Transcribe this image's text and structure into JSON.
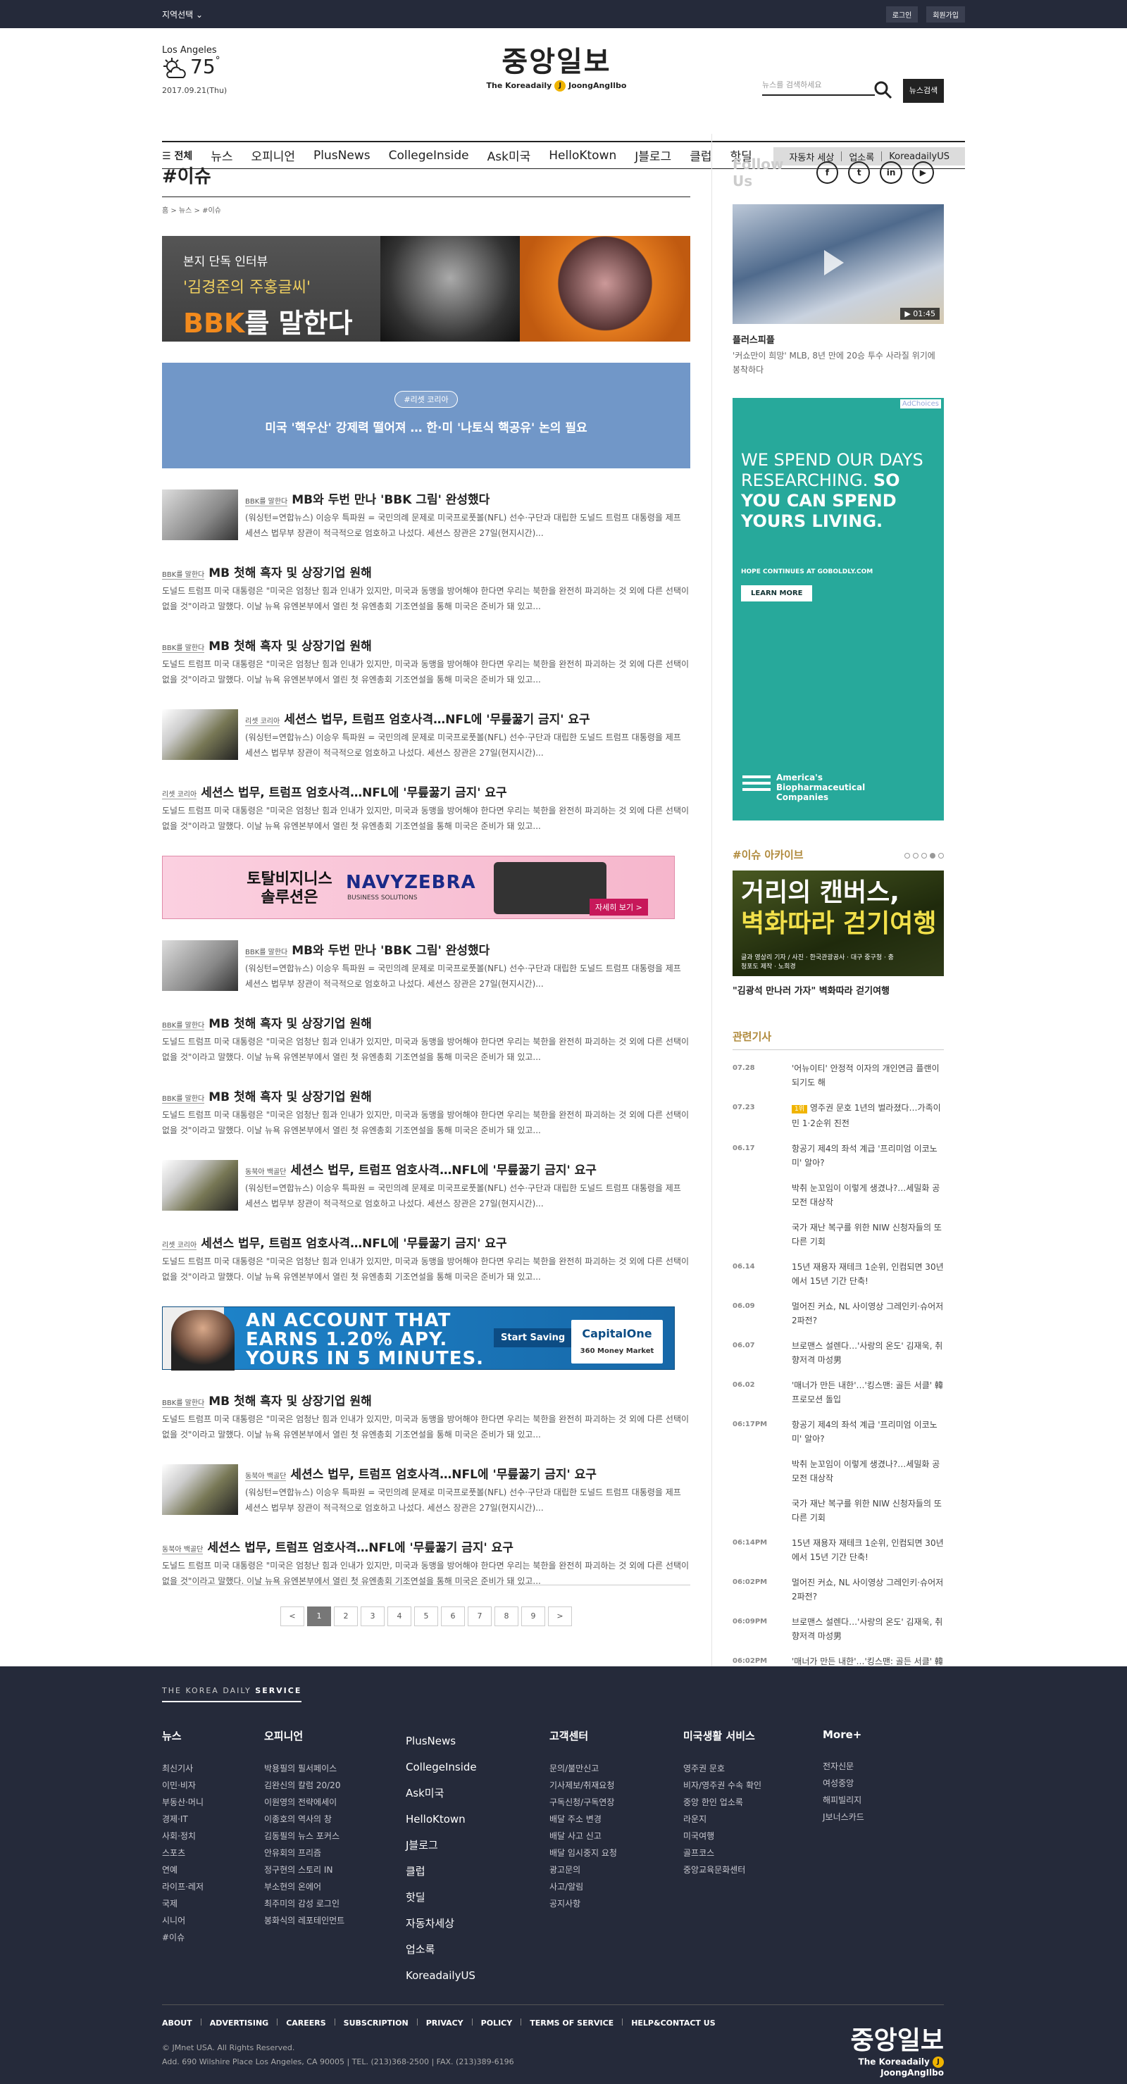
{
  "topbar": {
    "region": "지역선택",
    "login": "로그인",
    "join": "회원가입"
  },
  "weather": {
    "city": "Los Angeles",
    "temp": "75",
    "unit": "°",
    "date": "2017.09.21(Thu)"
  },
  "logo": {
    "ko": "중앙일보",
    "en_pre": "The Koreadaily",
    "en_mark": "J",
    "en_post": "JoongAngIlbo"
  },
  "search": {
    "placeholder": "뉴스를 검색하세요",
    "button": "뉴스검색"
  },
  "nav": {
    "all": "전체",
    "items": [
      "뉴스",
      "오피니언",
      "PlusNews",
      "CollegeInside",
      "Ask미국",
      "HelloKtown",
      "J블로그",
      "클럽",
      "핫딜"
    ],
    "extra": [
      "자동차 세상",
      "업소록",
      "KoreadailyUS"
    ]
  },
  "page": {
    "title": "#이슈",
    "breadcrumb": "홈 > 뉴스 > #이슈"
  },
  "banner_bbk": {
    "l1": "본지 단독 인터뷰",
    "l2": "'김경준의 주홍글씨'",
    "l3a": "BBK",
    "l3b": "를 말한다"
  },
  "banner_blue": {
    "tag": "#리셋 코리아",
    "title": "미국 '핵우산' 강제력 떨어져 … 한·미 '나토식 핵공유' 논의 필요"
  },
  "articles1": [
    {
      "sec": "BBK를 말한다",
      "title": "MB와 두번 만나 'BBK 그림' 완성했다",
      "summary": "(워싱턴=연합뉴스) 이승우 특파원 = 국민의례 문제로 미국프로풋볼(NFL) 선수·구단과 대립한 도널드 트럼프 대통령을 제프 세션스 법무부 장관이 적극적으로 엄호하고 나섰다. 세션스 장관은 27일(현지시간)..."
    },
    {
      "sec": "BBK를 말한다",
      "title": "MB 첫해 흑자 및 상장기업 원해",
      "summary": "도널드 트럼프 미국 대통령은 \"미국은 엄청난 힘과 인내가 있지만, 미국과 동맹을 방어해야 한다면 우리는 북한을 완전히 파괴하는 것 외에 다른 선택이 없을 것\"이라고 말했다. 이날 뉴욕 유엔본부에서 열린 첫 유엔총회 기조연설을 통해 미국은 준비가 돼 있고..."
    },
    {
      "sec": "BBK를 말한다",
      "title": "MB 첫해 흑자 및 상장기업 원해",
      "summary": "도널드 트럼프 미국 대통령은 \"미국은 엄청난 힘과 인내가 있지만, 미국과 동맹을 방어해야 한다면 우리는 북한을 완전히 파괴하는 것 외에 다른 선택이 없을 것\"이라고 말했다. 이날 뉴욕 유엔본부에서 열린 첫 유엔총회 기조연설을 통해 미국은 준비가 돼 있고..."
    },
    {
      "sec": "리셋 코리아",
      "title": "세션스 법무, 트럼프 엄호사격…NFL에 '무릎꿇기 금지' 요구",
      "summary": "(워싱턴=연합뉴스) 이승우 특파원 = 국민의례 문제로 미국프로풋볼(NFL) 선수·구단과 대립한 도널드 트럼프 대통령을 제프 세션스 법무부 장관이 적극적으로 엄호하고 나섰다. 세션스 장관은 27일(현지시간)..."
    },
    {
      "sec": "리셋 코리아",
      "title": "세션스 법무, 트럼프 엄호사격…NFL에 '무릎꿇기 금지' 요구",
      "summary": "도널드 트럼프 미국 대통령은 \"미국은 엄청난 힘과 인내가 있지만, 미국과 동맹을 방어해야 한다면 우리는 북한을 완전히 파괴하는 것 외에 다른 선택이 없을 것\"이라고 말했다. 이날 뉴욕 유엔본부에서 열린 첫 유엔총회 기조연설을 통해 미국은 준비가 돼 있고..."
    }
  ],
  "ad_navy": {
    "t1": "토탈비지니스 솔루션은",
    "brand": "NAVYZEBRA",
    "sub": "BUSINESS SOLUTIONS",
    "cta": "자세히 보기 >"
  },
  "articles2": [
    {
      "sec": "BBK를 말한다",
      "title": "MB와 두번 만나 'BBK 그림' 완성했다",
      "summary": "(워싱턴=연합뉴스) 이승우 특파원 = 국민의례 문제로 미국프로풋볼(NFL) 선수·구단과 대립한 도널드 트럼프 대통령을 제프 세션스 법무부 장관이 적극적으로 엄호하고 나섰다. 세션스 장관은 27일(현지시간)..."
    },
    {
      "sec": "BBK를 말한다",
      "title": "MB 첫해 흑자 및 상장기업 원해",
      "summary": "도널드 트럼프 미국 대통령은 \"미국은 엄청난 힘과 인내가 있지만, 미국과 동맹을 방어해야 한다면 우리는 북한을 완전히 파괴하는 것 외에 다른 선택이 없을 것\"이라고 말했다. 이날 뉴욕 유엔본부에서 열린 첫 유엔총회 기조연설을 통해 미국은 준비가 돼 있고..."
    },
    {
      "sec": "BBK를 말한다",
      "title": "MB 첫해 흑자 및 상장기업 원해",
      "summary": "도널드 트럼프 미국 대통령은 \"미국은 엄청난 힘과 인내가 있지만, 미국과 동맹을 방어해야 한다면 우리는 북한을 완전히 파괴하는 것 외에 다른 선택이 없을 것\"이라고 말했다. 이날 뉴욕 유엔본부에서 열린 첫 유엔총회 기조연설을 통해 미국은 준비가 돼 있고..."
    },
    {
      "sec": "동북아 백골단",
      "title": "세션스 법무, 트럼프 엄호사격…NFL에 '무릎꿇기 금지' 요구",
      "summary": "(워싱턴=연합뉴스) 이승우 특파원 = 국민의례 문제로 미국프로풋볼(NFL) 선수·구단과 대립한 도널드 트럼프 대통령을 제프 세션스 법무부 장관이 적극적으로 엄호하고 나섰다. 세션스 장관은 27일(현지시간)..."
    },
    {
      "sec": "리셋 코리아",
      "title": "세션스 법무, 트럼프 엄호사격…NFL에 '무릎꿇기 금지' 요구",
      "summary": "도널드 트럼프 미국 대통령은 \"미국은 엄청난 힘과 인내가 있지만, 미국과 동맹을 방어해야 한다면 우리는 북한을 완전히 파괴하는 것 외에 다른 선택이 없을 것\"이라고 말했다. 이날 뉴욕 유엔본부에서 열린 첫 유엔총회 기조연설을 통해 미국은 준비가 돼 있고..."
    }
  ],
  "ad_capital": {
    "text": "AN ACCOUNT THAT EARNS 1.20% APY. YOURS IN 5 MINUTES.",
    "btn": "Start Saving",
    "brand": "CapitalOne",
    "product": "360 Money Market"
  },
  "articles3": [
    {
      "sec": "BBK를 말한다",
      "title": "MB 첫해 흑자 및 상장기업 원해",
      "summary": "도널드 트럼프 미국 대통령은 \"미국은 엄청난 힘과 인내가 있지만, 미국과 동맹을 방어해야 한다면 우리는 북한을 완전히 파괴하는 것 외에 다른 선택이 없을 것\"이라고 말했다. 이날 뉴욕 유엔본부에서 열린 첫 유엔총회 기조연설을 통해 미국은 준비가 돼 있고..."
    },
    {
      "sec": "동북아 백골단",
      "title": "세션스 법무, 트럼프 엄호사격…NFL에 '무릎꿇기 금지' 요구",
      "summary": "(워싱턴=연합뉴스) 이승우 특파원 = 국민의례 문제로 미국프로풋볼(NFL) 선수·구단과 대립한 도널드 트럼프 대통령을 제프 세션스 법무부 장관이 적극적으로 엄호하고 나섰다. 세션스 장관은 27일(현지시간)..."
    },
    {
      "sec": "동북아 백골단",
      "title": "세션스 법무, 트럼프 엄호사격…NFL에 '무릎꿇기 금지' 요구",
      "summary": "도널드 트럼프 미국 대통령은 \"미국은 엄청난 힘과 인내가 있지만, 미국과 동맹을 방어해야 한다면 우리는 북한을 완전히 파괴하는 것 외에 다른 선택이 없을 것\"이라고 말했다. 이날 뉴욕 유엔본부에서 열린 첫 유엔총회 기조연설을 통해 미국은 준비가 돼 있고..."
    }
  ],
  "pager": {
    "prev": "<",
    "next": ">",
    "pages": [
      "1",
      "2",
      "3",
      "4",
      "5",
      "6",
      "7",
      "8",
      "9"
    ],
    "current": "1"
  },
  "side": {
    "follow": "Follow Us",
    "social": [
      "f",
      "t",
      "in",
      "▶"
    ],
    "video": {
      "duration": "01:45",
      "title": "플러스피플",
      "desc": "'커쇼만이 희망' MLB, 8년 만에 20승 투수 사라질 위기에 봉착하다"
    },
    "ad_green": {
      "adchoices": "AdChoices",
      "line1": "WE SPEND OUR DAYS RESEARCHING.",
      "line2": "SO YOU CAN SPEND YOURS LIVING.",
      "hope": "HOPE CONTINUES AT GOBOLDLY.COM",
      "learn": "LEARN MORE",
      "org": "America's Biopharmaceutical Companies"
    },
    "archive": {
      "title": "#이슈 아카이브",
      "img_l1": "거리의 캔버스,",
      "img_l2": "벽화따라 걷기여행",
      "img_sub": "글과 영상리 기자 / 사진 · 한국관광공사 · 대구 중구청 · 충청포도 제작 · 노희경",
      "caption": "\"김광석 만나러 가자\" 벽화따라 걷기여행"
    },
    "related_title": "관련기사",
    "related": [
      {
        "date": "07.28",
        "badge": "",
        "text": "'어뉴이티' 안정적 이자의 개인연금 플랜이 되기도 해"
      },
      {
        "date": "07.23",
        "badge": "1위",
        "text": "영주권 문호 1년의 벌라졌다…가족이민 1·2순위 진전"
      },
      {
        "date": "06.17",
        "badge": "",
        "text": "항공기 제4의 좌석 계급 '프리미엄 이코노미' 알아?"
      },
      {
        "date": "",
        "badge": "",
        "text": "박취 눈꼬임이 이렇게 생겼나?…세밀화 공모전 대상작"
      },
      {
        "date": "",
        "badge": "",
        "text": "국가 재난 복구를 위한 NIW 신청자들의 또 다른 기회"
      },
      {
        "date": "06.14",
        "badge": "",
        "text": "15년 재용자 재테크 1순위, 인컴되면 30년 에서 15년 기간 단축!"
      },
      {
        "date": "06.09",
        "badge": "",
        "text": "멀어진 커쇼, NL 사이영상 그레인키·슈어저 2파전?"
      },
      {
        "date": "06.07",
        "badge": "",
        "text": "브로맨스 설렌다…'사랑의 온도' 김재욱, 취향저격 마성男"
      },
      {
        "date": "06.02",
        "badge": "",
        "text": "'매너가 만든 내한'…'킹스맨: 골든 서클' 韓 프로모션 돌입"
      },
      {
        "date": "06:17PM",
        "badge": "",
        "text": "항공기 제4의 좌석 계급 '프리미엄 이코노미' 알아?"
      },
      {
        "date": "",
        "badge": "",
        "text": "박취 눈꼬임이 이렇게 생겼나?…세밀화 공모전 대상작"
      },
      {
        "date": "",
        "badge": "",
        "text": "국가 재난 복구를 위한 NIW 신청자들의 또 다른 기회"
      },
      {
        "date": "06:14PM",
        "badge": "",
        "text": "15년 재용자 재테크 1순위, 인컴되면 30년 에서 15년 기간 단축!"
      },
      {
        "date": "06:02PM",
        "badge": "",
        "text": "멀어진 커쇼, NL 사이영상 그레인키·슈어저 2파전?"
      },
      {
        "date": "06:09PM",
        "badge": "",
        "text": "브로맨스 설렌다…'사랑의 온도' 김재욱, 취향저격 마성男"
      },
      {
        "date": "06:02PM",
        "badge": "",
        "text": "'매너가 만든 내한'…'킹스맨: 골든 서클' 韓 프로모션 돌입"
      }
    ]
  },
  "footer": {
    "brand_a": "THE KOREA DAILY ",
    "brand_b": "SERVICE",
    "cols": [
      {
        "h": "뉴스",
        "items": [
          "최신기사",
          "이민·비자",
          "부동산·머니",
          "경제·IT",
          "사회·정치",
          "스포츠",
          "연예",
          "라이프·레저",
          "국제",
          "시니어",
          "#이슈"
        ]
      },
      {
        "h": "오피니언",
        "items": [
          "박용필의 필서페이스",
          "김완신의 칼럼 20/20",
          "이원영의 전략에세이",
          "이종호의 역사의 창",
          "김동필의 뉴스 포커스",
          "안유회의 프리즘",
          "정구현의 스토리 IN",
          "부소현의 온에어",
          "최주미의 감성 로그인",
          "봉화식의 레포테인먼트"
        ]
      },
      {
        "h": "",
        "big": [
          "PlusNews",
          "CollegeInside",
          "Ask미국",
          "HelloKtown",
          "J블로그",
          "클럽",
          "핫딜",
          "자동차세상",
          "업소록",
          "KoreadailyUS"
        ]
      },
      {
        "h": "고객센터",
        "items": [
          "문의/불만신고",
          "기사제보/취재요청",
          "구독신청/구독연장",
          "배달 주소 변경",
          "배달 사고 신고",
          "배달 임시중지 요청",
          "광고문의",
          "사고/알림",
          "공지사항"
        ]
      },
      {
        "h": "미국생활 서비스",
        "items": [
          "영주권 문호",
          "비자/영주권 수속 확인",
          "중앙 한인 업소록",
          "라운지",
          "미국여행",
          "골프코스",
          "중앙교육문화센터"
        ]
      },
      {
        "h": "More+",
        "items": [
          "전자신문",
          "여성중앙",
          "해피빌리지",
          "J보너스카드"
        ]
      }
    ],
    "links": [
      "ABOUT",
      "ADVERTISING",
      "CAREERS",
      "SUBSCRIPTION",
      "PRIVACY",
      "POLICY",
      "TERMS OF SERVICE",
      "HELP&CONTACT US"
    ],
    "copy1": "© JMnet USA. All Rights Reserved.",
    "copy2": "Add. 690 Wilshire Place Los Angeles, CA 90005  |  TEL. (213)368-2500  |  FAX. (213)389-6196"
  }
}
